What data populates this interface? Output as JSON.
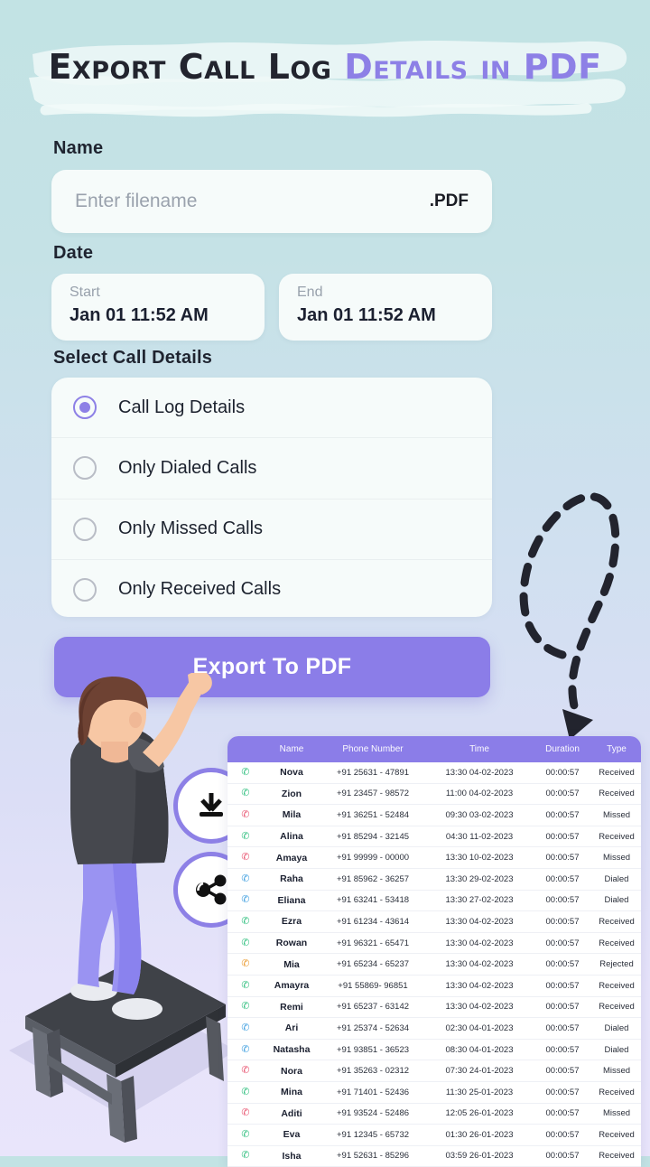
{
  "header": {
    "title_part1": "Export Call Log ",
    "title_part2": "Details in PDF",
    "accent_color": "#8d80e6"
  },
  "form": {
    "name_label": "Name",
    "name_placeholder": "Enter filename",
    "name_extension": ".PDF",
    "date_label": "Date",
    "start_caption": "Start",
    "start_value": "Jan 01 11:52 AM",
    "end_caption": "End",
    "end_value": "Jan 01 11:52 AM",
    "select_label": "Select Call Details",
    "options": [
      {
        "label": "Call Log Details",
        "selected": true
      },
      {
        "label": "Only Dialed Calls",
        "selected": false
      },
      {
        "label": "Only Missed Calls",
        "selected": false
      },
      {
        "label": "Only Received Calls",
        "selected": false
      }
    ],
    "export_button": "Export To PDF"
  },
  "actions": {
    "download_icon": "download-icon",
    "share_icon": "share-icon"
  },
  "table": {
    "columns": [
      "",
      "Name",
      "Phone Number",
      "Time",
      "Duration",
      "Type"
    ],
    "rows": [
      {
        "name": "Nova",
        "phone": "+91 25631 - 47891",
        "time": "13:30 04-02-2023",
        "duration": "00:00:57",
        "type": "Received"
      },
      {
        "name": "Zion",
        "phone": "+91 23457 - 98572",
        "time": "11:00 04-02-2023",
        "duration": "00:00:57",
        "type": "Received"
      },
      {
        "name": "Mila",
        "phone": "+91 36251 - 52484",
        "time": "09:30 03-02-2023",
        "duration": "00:00:57",
        "type": "Missed"
      },
      {
        "name": "Alina",
        "phone": "+91 85294 - 32145",
        "time": "04:30 11-02-2023",
        "duration": "00:00:57",
        "type": "Received"
      },
      {
        "name": "Amaya",
        "phone": "+91 99999 - 00000",
        "time": "13:30 10-02-2023",
        "duration": "00:00:57",
        "type": "Missed"
      },
      {
        "name": "Raha",
        "phone": "+91 85962 - 36257",
        "time": "13:30 29-02-2023",
        "duration": "00:00:57",
        "type": "Dialed"
      },
      {
        "name": "Eliana",
        "phone": "+91 63241 - 53418",
        "time": "13:30 27-02-2023",
        "duration": "00:00:57",
        "type": "Dialed"
      },
      {
        "name": "Ezra",
        "phone": "+91 61234 - 43614",
        "time": "13:30 04-02-2023",
        "duration": "00:00:57",
        "type": "Received"
      },
      {
        "name": "Rowan",
        "phone": "+91 96321 - 65471",
        "time": "13:30 04-02-2023",
        "duration": "00:00:57",
        "type": "Received"
      },
      {
        "name": "Mia",
        "phone": "+91 65234 - 65237",
        "time": "13:30 04-02-2023",
        "duration": "00:00:57",
        "type": "Rejected"
      },
      {
        "name": "Amayra",
        "phone": "+91 55869- 96851",
        "time": "13:30 04-02-2023",
        "duration": "00:00:57",
        "type": "Received"
      },
      {
        "name": "Remi",
        "phone": "+91 65237 - 63142",
        "time": "13:30 04-02-2023",
        "duration": "00:00:57",
        "type": "Received"
      },
      {
        "name": "Ari",
        "phone": "+91 25374 - 52634",
        "time": "02:30 04-01-2023",
        "duration": "00:00:57",
        "type": "Dialed"
      },
      {
        "name": "Natasha",
        "phone": "+91 93851 - 36523",
        "time": "08:30 04-01-2023",
        "duration": "00:00:57",
        "type": "Dialed"
      },
      {
        "name": "Nora",
        "phone": "+91 35263 - 02312",
        "time": "07:30 24-01-2023",
        "duration": "00:00:57",
        "type": "Missed"
      },
      {
        "name": "Mina",
        "phone": "+91 71401 - 52436",
        "time": "11:30 25-01-2023",
        "duration": "00:00:57",
        "type": "Received"
      },
      {
        "name": "Aditi",
        "phone": "+91 93524 - 52486",
        "time": "12:05 26-01-2023",
        "duration": "00:00:57",
        "type": "Missed"
      },
      {
        "name": "Eva",
        "phone": "+91 12345 - 65732",
        "time": "01:30 26-01-2023",
        "duration": "00:00:57",
        "type": "Received"
      },
      {
        "name": "Isha",
        "phone": "+91 52631 - 85296",
        "time": "03:59 26-01-2023",
        "duration": "00:00:57",
        "type": "Received"
      }
    ]
  },
  "colors": {
    "accent": "#8b7de8",
    "received": "#3fc98a",
    "missed": "#f2607a",
    "dialed": "#4aa8e8",
    "rejected": "#f2a33c"
  }
}
